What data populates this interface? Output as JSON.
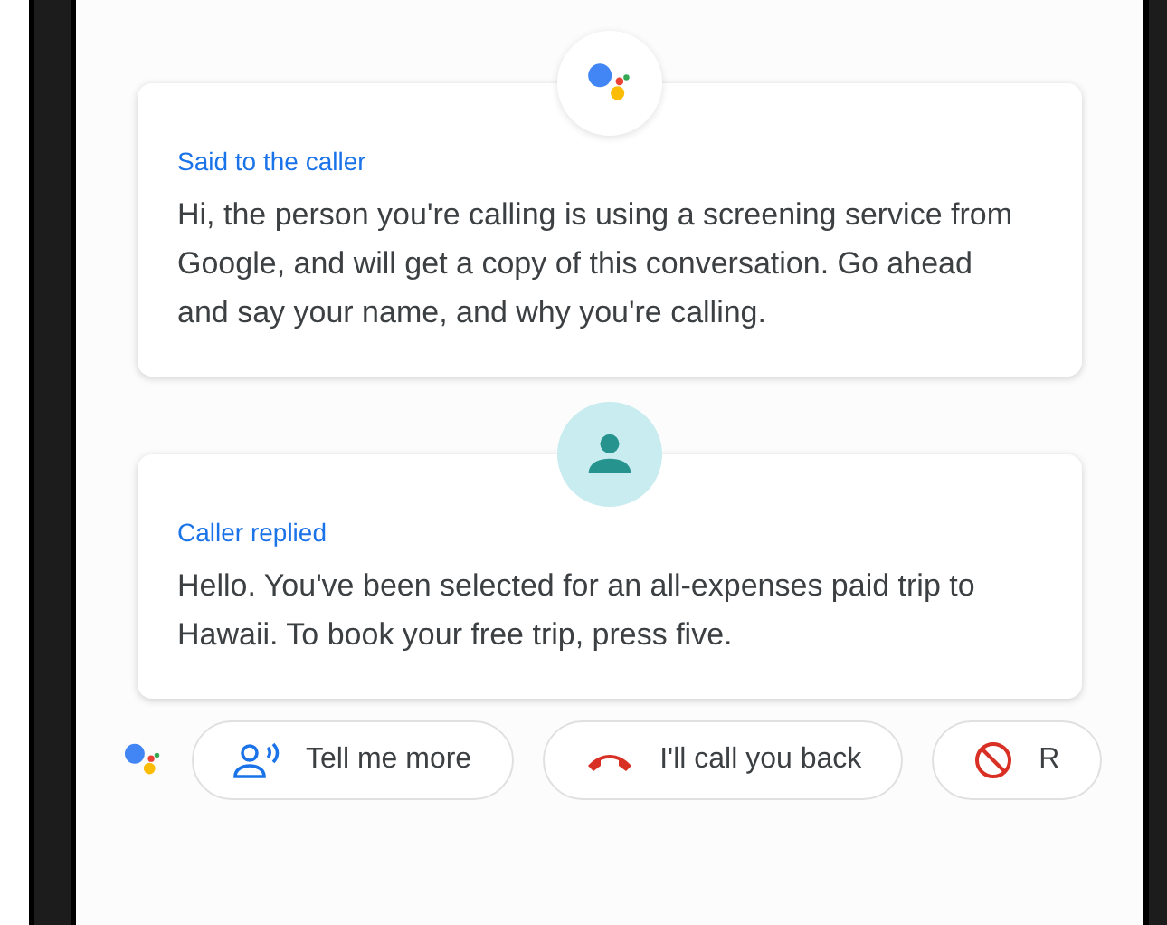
{
  "messages": [
    {
      "kind": "assistant",
      "label": "Said to the caller",
      "text": "Hi, the person you're calling is using a screening service from Google, and will get a copy of this conversation. Go ahead and say your name, and why you're calling."
    },
    {
      "kind": "caller",
      "label": "Caller replied",
      "text": "Hello. You've been selected for an all-expenses paid trip to Hawaii. To book your free trip, press five."
    }
  ],
  "chips": [
    {
      "kind": "tell",
      "label": "Tell me more"
    },
    {
      "kind": "callback",
      "label": "I'll call you back"
    },
    {
      "kind": "block",
      "label": "R"
    }
  ]
}
